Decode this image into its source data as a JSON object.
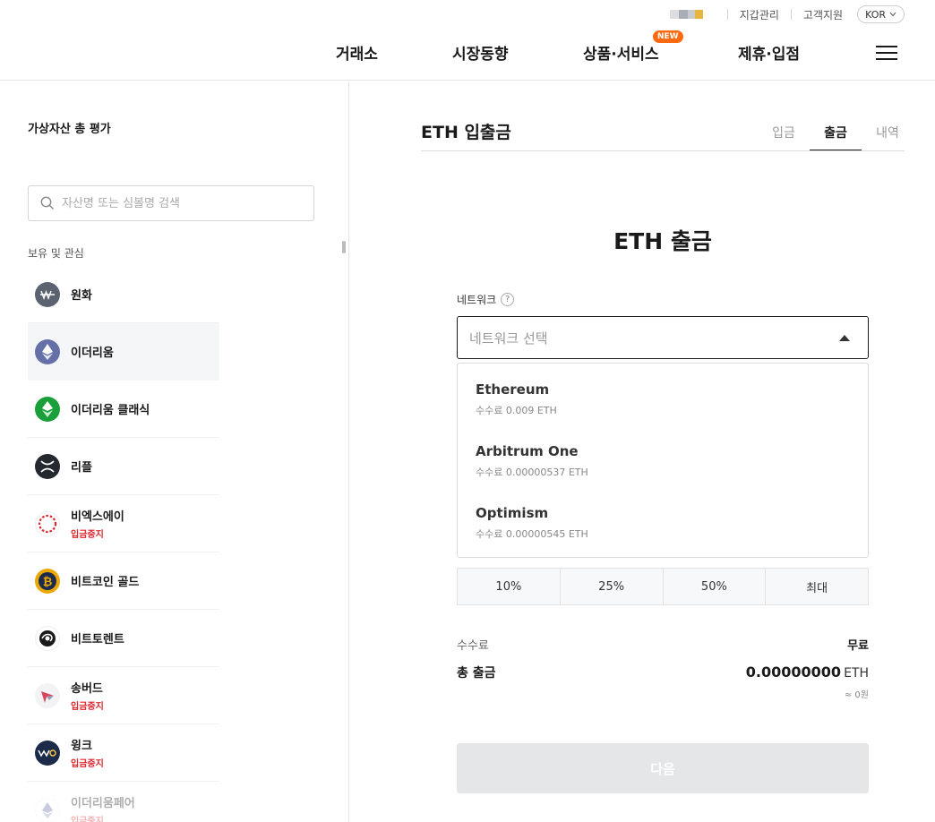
{
  "header": {
    "utility": {
      "wallet": "지갑관리",
      "support": "고객지원",
      "language": "KOR"
    },
    "nav": [
      {
        "label": "거래소"
      },
      {
        "label": "시장동향"
      },
      {
        "label": "상품·서비스",
        "badge": "NEW"
      },
      {
        "label": "제휴·입점"
      }
    ]
  },
  "sidebar": {
    "title": "가상자산 총 평가",
    "search_placeholder": "자산명 또는 심볼명 검색",
    "section_label": "보유 및 관심",
    "assets": [
      {
        "name": "원화",
        "status": "",
        "icon": "krw-coin-icon",
        "color": "#5b6370"
      },
      {
        "name": "이더리움",
        "status": "",
        "icon": "ethereum-coin-icon",
        "color": "#6670a8"
      },
      {
        "name": "이더리움 클래식",
        "status": "",
        "icon": "ethereum-classic-coin-icon",
        "color": "#1a9f3a"
      },
      {
        "name": "리플",
        "status": "",
        "icon": "xrp-coin-icon",
        "color": "#23292f"
      },
      {
        "name": "비엑스에이",
        "status": "입금중지",
        "icon": "bxa-coin-icon",
        "color": "#e0242c"
      },
      {
        "name": "비트코인 골드",
        "status": "",
        "icon": "bitcoin-gold-coin-icon",
        "color": "#eba809"
      },
      {
        "name": "비트토렌트",
        "status": "",
        "icon": "bittorrent-coin-icon",
        "color": "#1a1a1a"
      },
      {
        "name": "송버드",
        "status": "입금중지",
        "icon": "songbird-coin-icon",
        "color": "#d9455f"
      },
      {
        "name": "윙크",
        "status": "입금중지",
        "icon": "wink-coin-icon",
        "color": "#1c2b4a"
      },
      {
        "name": "이더리움페어",
        "status": "입금중지",
        "icon": "ethereum-fair-coin-icon",
        "color": "#6670a8"
      }
    ]
  },
  "main": {
    "title": "ETH 입출금",
    "tabs": [
      "입금",
      "출금",
      "내역"
    ],
    "active_tab": "출금",
    "form_title": "ETH 출금",
    "network_label": "네트워크",
    "network_placeholder": "네트워크 선택",
    "network_options": [
      {
        "name": "Ethereum",
        "fee": "수수료 0.009 ETH"
      },
      {
        "name": "Arbitrum One",
        "fee": "수수료 0.00000537 ETH"
      },
      {
        "name": "Optimism",
        "fee": "수수료 0.00000545 ETH"
      }
    ],
    "percent_buttons": [
      "10%",
      "25%",
      "50%",
      "최대"
    ],
    "fee_label": "수수료",
    "fee_value": "무료",
    "total_label": "총 출금",
    "total_amount": "0.00000000",
    "total_unit": "ETH",
    "total_krw": "≈ 0원",
    "next_label": "다음"
  },
  "colors": {
    "accent_new": "#ff6a10",
    "alert_red": "#e0242c",
    "disabled_button": "#e5e6e8"
  }
}
